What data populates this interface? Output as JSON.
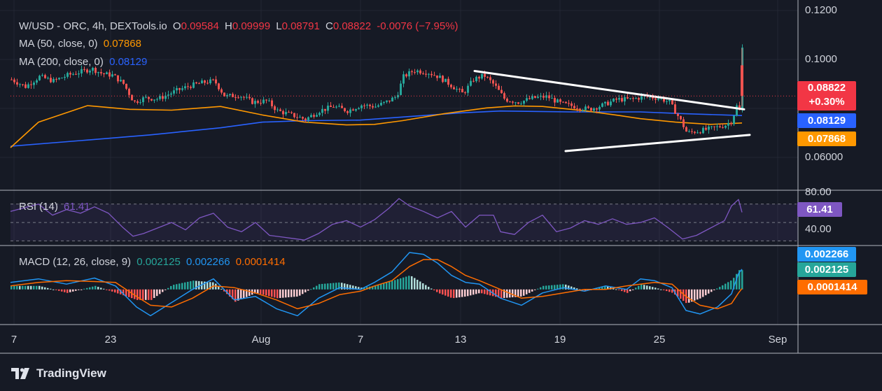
{
  "header": {
    "symbol": "W/USD - ORC, 4h, DEXTools.io",
    "o_label": "O",
    "o_value": "0.09584",
    "h_label": "H",
    "h_value": "0.09999",
    "l_label": "L",
    "l_value": "0.08791",
    "c_label": "C",
    "c_value": "0.08822",
    "change": "-0.0076 (−7.95%)"
  },
  "ma50": {
    "label": "MA (50, close, 0)",
    "value": "0.07868",
    "color": "#ff9800"
  },
  "ma200": {
    "label": "MA (200, close, 0)",
    "value": "0.08129",
    "color": "#2962ff"
  },
  "rsi": {
    "label": "RSI (14)",
    "value": "61.41",
    "color": "#7e57c2"
  },
  "macd": {
    "label": "MACD (12, 26, close, 9)",
    "hist_value": "0.002125",
    "macd_value": "0.002266",
    "signal_value": "0.0001414"
  },
  "price_tags": {
    "last": "0.08822",
    "last_change": "+0.30%",
    "ma200": "0.08129",
    "ma50": "0.07868"
  },
  "price_axis": [
    "0.1200",
    "0.1000",
    "0.06000"
  ],
  "rsi_axis": [
    "80.00",
    "40.00"
  ],
  "macd_tags": [
    "0.002266",
    "0.002125",
    "0.0001414"
  ],
  "x_axis": [
    "7",
    "23",
    "Aug",
    "7",
    "13",
    "19",
    "25",
    "Sep"
  ],
  "brand": "TradingView",
  "colors": {
    "background": "#161a25",
    "up": "#26a69a",
    "down": "#ef5350",
    "ma50": "#ff9800",
    "ma200": "#2962ff",
    "rsi": "#7e57c2",
    "macd_line": "#2196f3",
    "signal_line": "#ff6d00",
    "trendline": "#ffffff"
  },
  "chart_data": {
    "type": "candlestick",
    "symbol": "W/USD",
    "interval": "4h",
    "price_range": [
      0.055,
      0.122
    ],
    "x_ticks": [
      "7",
      "23",
      "Aug",
      "7",
      "13",
      "19",
      "25",
      "Sep"
    ],
    "ma50": [
      [
        0,
        0.07
      ],
      [
        40,
        0.079
      ],
      [
        110,
        0.0848
      ],
      [
        170,
        0.0835
      ],
      [
        230,
        0.0832
      ],
      [
        300,
        0.0845
      ],
      [
        360,
        0.0815
      ],
      [
        420,
        0.079
      ],
      [
        480,
        0.078
      ],
      [
        520,
        0.0782
      ],
      [
        560,
        0.0795
      ],
      [
        620,
        0.082
      ],
      [
        680,
        0.084
      ],
      [
        720,
        0.0847
      ],
      [
        760,
        0.0845
      ],
      [
        820,
        0.083
      ],
      [
        870,
        0.0813
      ],
      [
        900,
        0.0802
      ],
      [
        950,
        0.079
      ],
      [
        1000,
        0.0782
      ],
      [
        1030,
        0.0785
      ],
      [
        1045,
        0.0787
      ]
    ],
    "ma200": [
      [
        0,
        0.0705
      ],
      [
        100,
        0.0725
      ],
      [
        200,
        0.0745
      ],
      [
        300,
        0.077
      ],
      [
        360,
        0.079
      ],
      [
        420,
        0.0795
      ],
      [
        500,
        0.0797
      ],
      [
        560,
        0.0808
      ],
      [
        640,
        0.0822
      ],
      [
        700,
        0.0829
      ],
      [
        800,
        0.0826
      ],
      [
        900,
        0.0826
      ],
      [
        960,
        0.082
      ],
      [
        1045,
        0.0813
      ]
    ],
    "rsi": {
      "levels": [
        70,
        50,
        30
      ],
      "axis_range": [
        25,
        85
      ],
      "values": [
        [
          0,
          62
        ],
        [
          20,
          66
        ],
        [
          40,
          70
        ],
        [
          60,
          58
        ],
        [
          80,
          64
        ],
        [
          100,
          60
        ],
        [
          120,
          67
        ],
        [
          140,
          60
        ],
        [
          160,
          45
        ],
        [
          175,
          35
        ],
        [
          190,
          38
        ],
        [
          210,
          44
        ],
        [
          230,
          50
        ],
        [
          250,
          42
        ],
        [
          270,
          55
        ],
        [
          290,
          60
        ],
        [
          310,
          45
        ],
        [
          330,
          40
        ],
        [
          350,
          50
        ],
        [
          370,
          36
        ],
        [
          390,
          34
        ],
        [
          410,
          32
        ],
        [
          420,
          31
        ],
        [
          440,
          38
        ],
        [
          460,
          48
        ],
        [
          480,
          52
        ],
        [
          500,
          45
        ],
        [
          520,
          53
        ],
        [
          540,
          65
        ],
        [
          555,
          76
        ],
        [
          570,
          68
        ],
        [
          590,
          62
        ],
        [
          610,
          55
        ],
        [
          630,
          62
        ],
        [
          650,
          45
        ],
        [
          670,
          58
        ],
        [
          690,
          58
        ],
        [
          700,
          40
        ],
        [
          720,
          37
        ],
        [
          740,
          50
        ],
        [
          760,
          58
        ],
        [
          780,
          40
        ],
        [
          800,
          44
        ],
        [
          820,
          52
        ],
        [
          840,
          48
        ],
        [
          860,
          54
        ],
        [
          880,
          48
        ],
        [
          900,
          50
        ],
        [
          920,
          55
        ],
        [
          940,
          44
        ],
        [
          960,
          32
        ],
        [
          980,
          36
        ],
        [
          1000,
          44
        ],
        [
          1020,
          52
        ],
        [
          1030,
          68
        ],
        [
          1040,
          75
        ],
        [
          1045,
          61
        ]
      ]
    },
    "macd": {
      "axis_range": [
        -0.004,
        0.005
      ],
      "macd_line": [
        [
          0,
          0.0008
        ],
        [
          40,
          0.0012
        ],
        [
          80,
          0.0006
        ],
        [
          120,
          0.0013
        ],
        [
          150,
          0.0004
        ],
        [
          180,
          -0.002
        ],
        [
          200,
          -0.003
        ],
        [
          230,
          -0.0015
        ],
        [
          260,
          0.0
        ],
        [
          290,
          0.0012
        ],
        [
          320,
          -0.0012
        ],
        [
          350,
          -0.0008
        ],
        [
          380,
          -0.0022
        ],
        [
          410,
          -0.003
        ],
        [
          440,
          -0.001
        ],
        [
          470,
          0.0002
        ],
        [
          500,
          0.0
        ],
        [
          520,
          0.0008
        ],
        [
          545,
          0.002
        ],
        [
          570,
          0.0042
        ],
        [
          590,
          0.004
        ],
        [
          610,
          0.003
        ],
        [
          630,
          0.0016
        ],
        [
          650,
          0.0008
        ],
        [
          670,
          0.0006
        ],
        [
          700,
          -0.001
        ],
        [
          730,
          -0.0018
        ],
        [
          760,
          -0.0004
        ],
        [
          790,
          0.0002
        ],
        [
          820,
          -0.0002
        ],
        [
          850,
          0.0004
        ],
        [
          880,
          0.0
        ],
        [
          900,
          0.0012
        ],
        [
          920,
          0.001
        ],
        [
          945,
          0.0002
        ],
        [
          965,
          -0.0024
        ],
        [
          985,
          -0.0028
        ],
        [
          1010,
          -0.002
        ],
        [
          1030,
          -0.0005
        ],
        [
          1040,
          0.0018
        ],
        [
          1045,
          0.0023
        ]
      ],
      "signal_line": [
        [
          0,
          0.0004
        ],
        [
          40,
          0.0008
        ],
        [
          80,
          0.001
        ],
        [
          120,
          0.0009
        ],
        [
          150,
          0.0008
        ],
        [
          180,
          -0.0008
        ],
        [
          200,
          -0.0018
        ],
        [
          230,
          -0.002
        ],
        [
          260,
          -0.001
        ],
        [
          290,
          0.0004
        ],
        [
          320,
          0.0002
        ],
        [
          350,
          -0.0004
        ],
        [
          380,
          -0.0012
        ],
        [
          410,
          -0.0022
        ],
        [
          440,
          -0.0016
        ],
        [
          470,
          -0.0006
        ],
        [
          500,
          -0.0002
        ],
        [
          520,
          0.0004
        ],
        [
          545,
          0.001
        ],
        [
          570,
          0.0026
        ],
        [
          590,
          0.0034
        ],
        [
          610,
          0.0034
        ],
        [
          630,
          0.0026
        ],
        [
          650,
          0.0016
        ],
        [
          670,
          0.001
        ],
        [
          700,
          0.0
        ],
        [
          730,
          -0.001
        ],
        [
          760,
          -0.0008
        ],
        [
          790,
          -0.0004
        ],
        [
          820,
          0.0
        ],
        [
          850,
          0.0
        ],
        [
          880,
          0.0004
        ],
        [
          900,
          0.0006
        ],
        [
          920,
          0.0008
        ],
        [
          945,
          0.0006
        ],
        [
          965,
          -0.0008
        ],
        [
          985,
          -0.0018
        ],
        [
          1010,
          -0.0022
        ],
        [
          1030,
          -0.0016
        ],
        [
          1040,
          -0.0004
        ],
        [
          1045,
          0.0001
        ]
      ]
    },
    "trendlines": [
      {
        "from": [
          678,
          0.097
        ],
        "to": [
          1063,
          0.0835
        ]
      },
      {
        "from": [
          808,
          0.0688
        ],
        "to": [
          1071,
          0.0745
        ]
      }
    ]
  }
}
